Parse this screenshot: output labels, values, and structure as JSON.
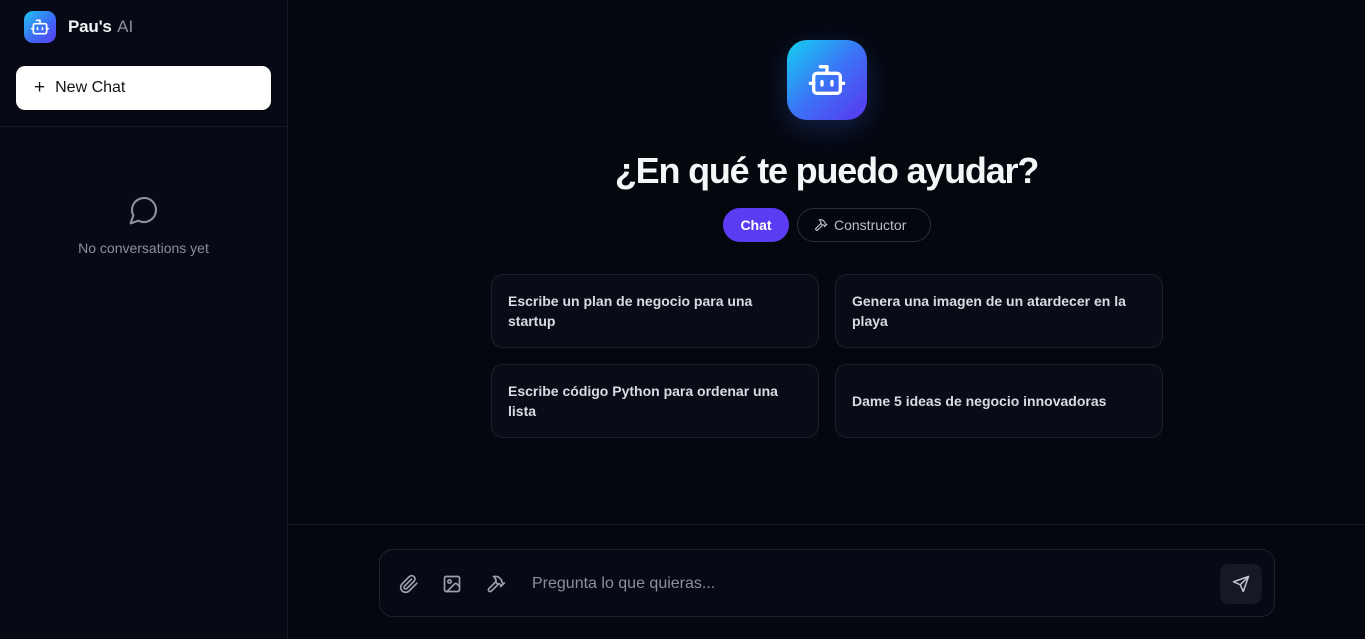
{
  "sidebar": {
    "brand_name": "Pau's",
    "brand_suffix": "AI",
    "new_chat_label": "New Chat",
    "empty_text": "No conversations yet"
  },
  "main": {
    "headline": "¿En qué te puedo ayudar?",
    "modes": [
      {
        "label": "Chat",
        "active": true
      },
      {
        "label": "Constructor",
        "active": false
      }
    ],
    "suggestions": [
      "Escribe un plan de negocio para una startup",
      "Genera una imagen de un atardecer en la playa",
      "Escribe código Python para ordenar una lista",
      "Dame 5 ideas de negocio innovadoras"
    ]
  },
  "composer": {
    "placeholder": "Pregunta lo que quieras...",
    "tools": [
      "paperclip-icon",
      "image-icon",
      "hammer-icon"
    ]
  },
  "colors": {
    "background": "#05070f",
    "accent": "#5b3cf2",
    "logo_gradient_start": "#14d0ef",
    "logo_gradient_end": "#5a35ef"
  }
}
